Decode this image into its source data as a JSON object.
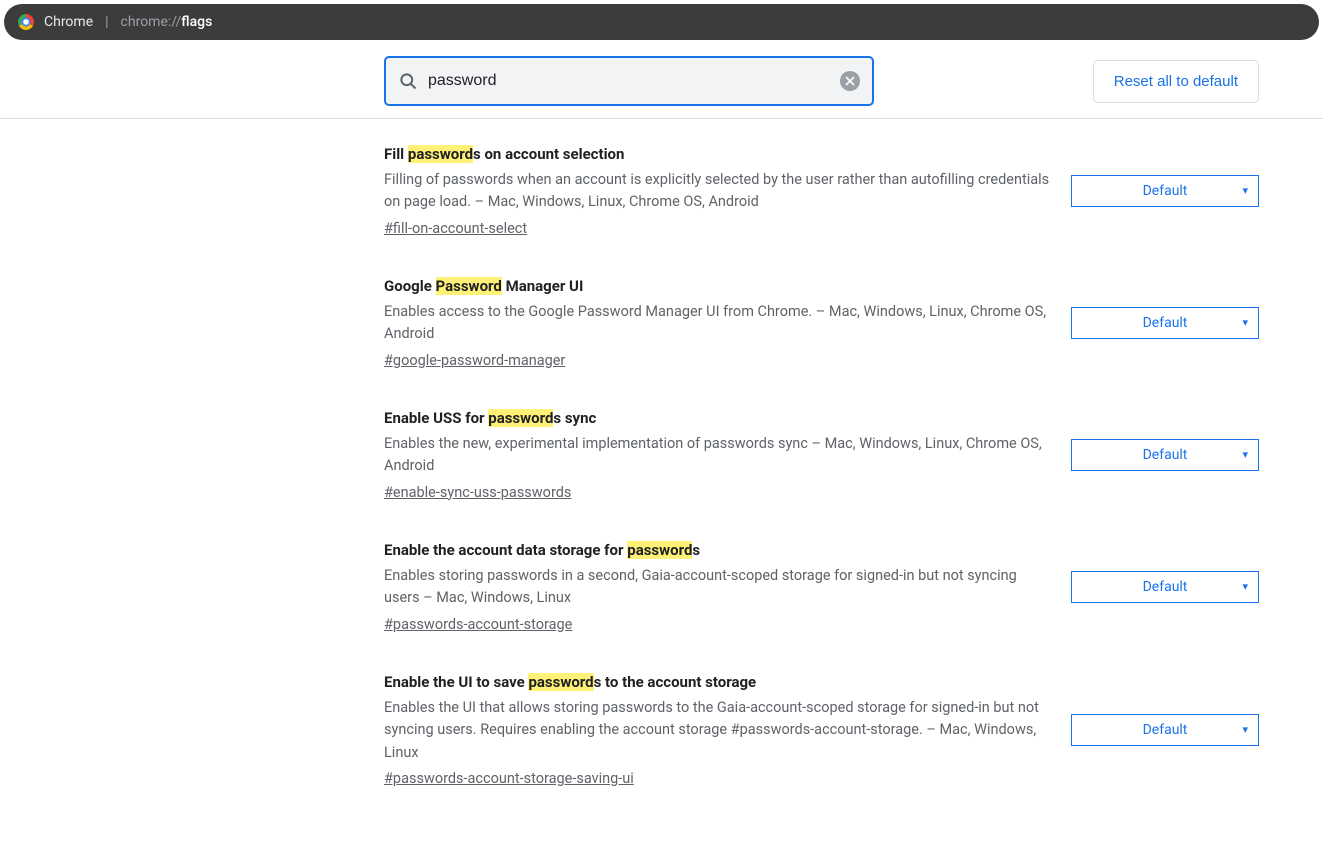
{
  "address_bar": {
    "label": "Chrome",
    "protocol": "chrome://",
    "path": "flags"
  },
  "header": {
    "search_value": "password",
    "reset_label": "Reset all to default"
  },
  "highlight_term": "password",
  "flags": [
    {
      "title": "Fill passwords on account selection",
      "description": "Filling of passwords when an account is explicitly selected by the user rather than autofilling credentials on page load. – Mac, Windows, Linux, Chrome OS, Android",
      "hash": "#fill-on-account-select",
      "value": "Default"
    },
    {
      "title": "Google Password Manager UI",
      "description": "Enables access to the Google Password Manager UI from Chrome. – Mac, Windows, Linux, Chrome OS, Android",
      "hash": "#google-password-manager",
      "value": "Default"
    },
    {
      "title": "Enable USS for passwords sync",
      "description": "Enables the new, experimental implementation of passwords sync – Mac, Windows, Linux, Chrome OS, Android",
      "hash": "#enable-sync-uss-passwords",
      "value": "Default"
    },
    {
      "title": "Enable the account data storage for passwords",
      "description": "Enables storing passwords in a second, Gaia-account-scoped storage for signed-in but not syncing users – Mac, Windows, Linux",
      "hash": "#passwords-account-storage",
      "value": "Default"
    },
    {
      "title": "Enable the UI to save passwords to the account storage",
      "description": "Enables the UI that allows storing passwords to the Gaia-account-scoped storage for signed-in but not syncing users. Requires enabling the account storage #passwords-account-storage. – Mac, Windows, Linux",
      "hash": "#passwords-account-storage-saving-ui",
      "value": "Default"
    }
  ]
}
